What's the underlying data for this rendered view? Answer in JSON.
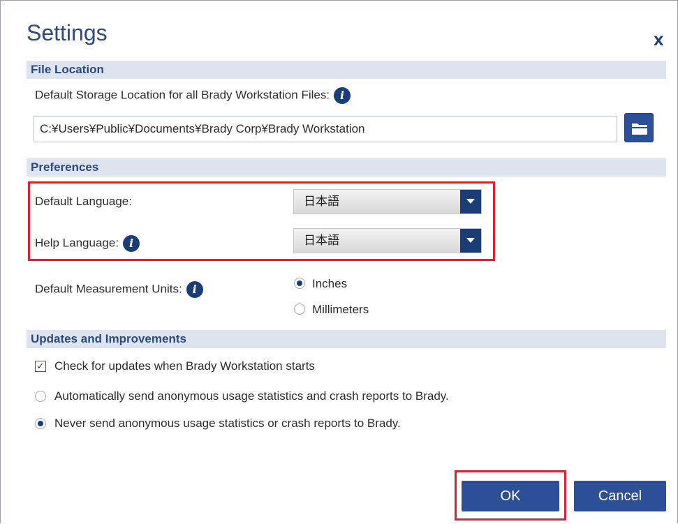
{
  "dialog": {
    "title": "Settings",
    "close_label": "x"
  },
  "file_location": {
    "header": "File Location",
    "storage_label": "Default Storage Location for all Brady Workstation Files:",
    "storage_path": "C:¥Users¥Public¥Documents¥Brady Corp¥Brady Workstation"
  },
  "preferences": {
    "header": "Preferences",
    "default_language_label": "Default Language:",
    "default_language_value": "日本語",
    "help_language_label": "Help Language:",
    "help_language_value": "日本語",
    "units_label": "Default Measurement Units:",
    "units_options": [
      "Inches",
      "Millimeters"
    ],
    "units_selected": "Inches"
  },
  "updates": {
    "header": "Updates and Improvements",
    "check_updates_label": "Check for updates when Brady Workstation starts",
    "check_updates_checked": true,
    "auto_send_label": "Automatically send anonymous usage statistics and crash reports to Brady.",
    "never_send_label": "Never send anonymous usage statistics or crash reports to Brady.",
    "selected": "never"
  },
  "buttons": {
    "ok": "OK",
    "cancel": "Cancel"
  },
  "icons": {
    "info": "info-icon",
    "folder": "folder-icon",
    "dropdown": "chevron-down-icon"
  },
  "colors": {
    "accent": "#2d4f98",
    "section_bg": "#dde4ef",
    "highlight": "#e02030"
  }
}
